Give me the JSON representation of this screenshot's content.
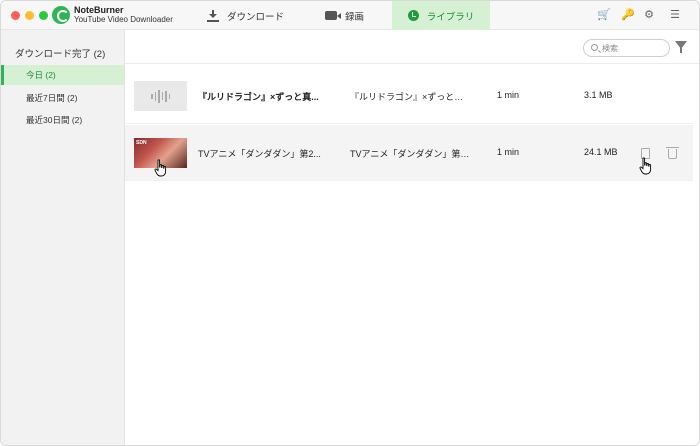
{
  "app": {
    "name": "NoteBurner",
    "subtitle": "YouTube Video Downloader"
  },
  "nav": {
    "download": "ダウンロード",
    "record": "録画",
    "library": "ライブラリ"
  },
  "sidebar": {
    "header": "ダウンロード完了 (2)",
    "items": [
      {
        "label": "今日 (2)",
        "active": true
      },
      {
        "label": "最近7日間 (2)",
        "active": false
      },
      {
        "label": "最近30日間 (2)",
        "active": false
      }
    ]
  },
  "search": {
    "placeholder": "検索"
  },
  "rows": [
    {
      "title": "『ルリドラゴン』×ずっと真...",
      "desc": "『ルリドラゴン』×ずっと真...",
      "duration": "1 min",
      "size": "3.1 MB",
      "thumb": "audio"
    },
    {
      "title": "TVアニメ「ダンダダン」第2...",
      "desc": "TVアニメ「ダンダダン」第2...",
      "duration": "1 min",
      "size": "24.1 MB",
      "thumb": "video"
    }
  ],
  "colors": {
    "accent": "#2fb553",
    "accent_bg": "#d6f0d3",
    "toolbar_icon": "#f07a1a"
  },
  "icons": [
    "download-icon",
    "record-icon",
    "library-icon",
    "cart-icon",
    "key-icon",
    "gear-icon",
    "menu-icon",
    "search-icon",
    "filter-icon",
    "file-icon",
    "trash-icon"
  ]
}
